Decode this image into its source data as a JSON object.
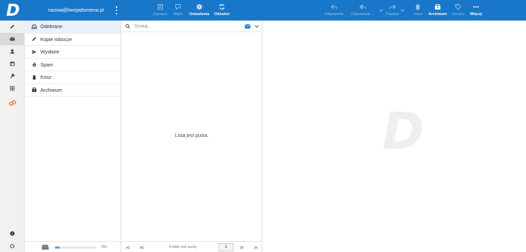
{
  "brand": {
    "logo_letter": "D",
    "watermark_letter": "D",
    "accent": "#1877c9"
  },
  "account": {
    "email": "nazwa@twojadomena.pl"
  },
  "toolbar": {
    "mark": "Zaznacz",
    "threads": "Wątki",
    "settings": "Ustawienia",
    "refresh": "Odśwież",
    "reply": "Odpowiedz",
    "reply_all": "Odpowiedz ...",
    "forward": "Przekaż",
    "delete": "Usuń",
    "archive": "Archiwum",
    "mark_as": "Oznacz",
    "more": "Więcej"
  },
  "rail": {
    "items": [
      "compose-icon",
      "mail-icon",
      "contacts-icon",
      "calendar-icon",
      "settings-wrench-icon",
      "apps-grid-icon",
      "plugin-icon"
    ],
    "bottom": [
      "info-icon",
      "power-icon"
    ]
  },
  "folders": [
    {
      "label": "Odebrane",
      "icon": "inbox-icon"
    },
    {
      "label": "Kopie robocze",
      "icon": "pencil-icon"
    },
    {
      "label": "Wysłane",
      "icon": "send-icon"
    },
    {
      "label": "Spam",
      "icon": "fire-icon"
    },
    {
      "label": "Kosz",
      "icon": "trash-icon"
    },
    {
      "label": "Archiwum",
      "icon": "archive-icon"
    }
  ],
  "quota": {
    "percent_label": "0%",
    "fraction": 0.12
  },
  "list": {
    "search_placeholder": "Szukaj...",
    "empty_message": "Lista jest pusta.",
    "pager_text": "Folder jest pusty",
    "page_number": "1"
  }
}
